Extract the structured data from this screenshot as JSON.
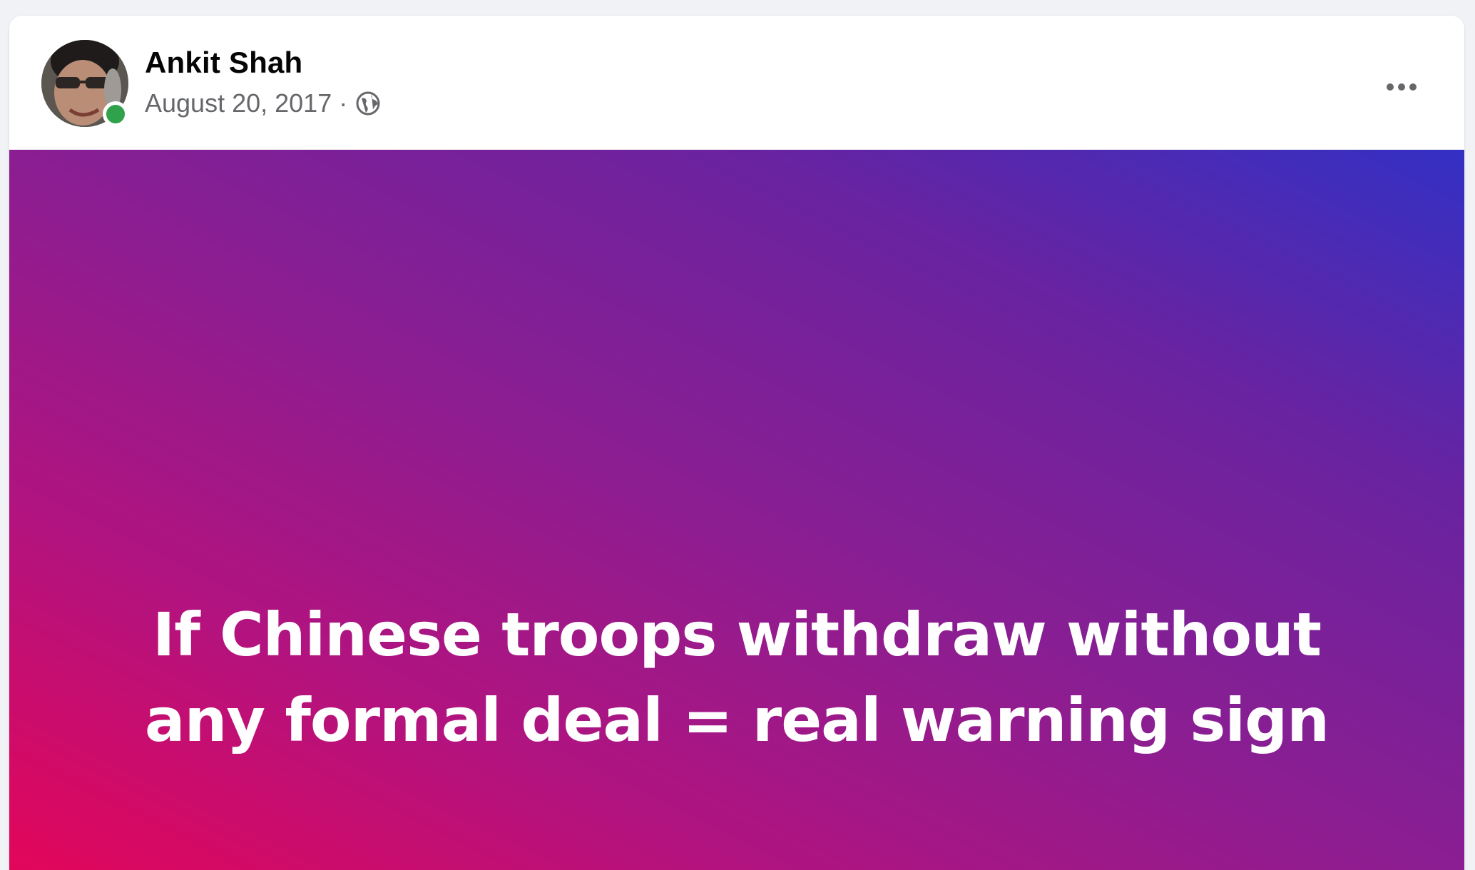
{
  "post": {
    "author_name": "Ankit Shah",
    "date": "August 20, 2017",
    "separator": "·",
    "privacy_icon": "globe-icon",
    "status_color": "#31a24c",
    "text": "If Chinese troops withdraw without any formal deal = real warning sign",
    "background_gradient": [
      "#e2065a",
      "#8a1e92",
      "#3330c4"
    ]
  },
  "icons": {
    "more": "more-horizontal-icon"
  }
}
